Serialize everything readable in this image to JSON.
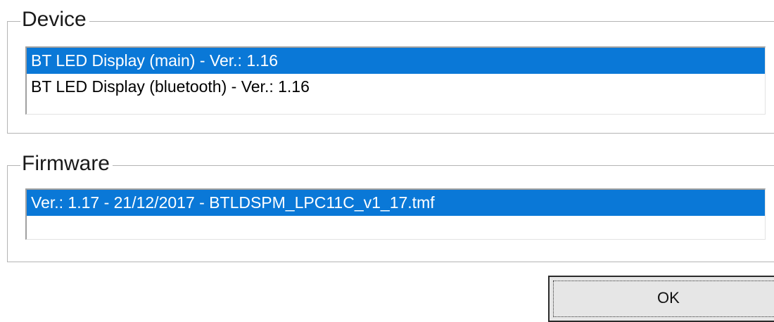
{
  "device_group": {
    "title": "Device",
    "items": [
      {
        "label": "BT LED Display (main) - Ver.: 1.16",
        "selected": true
      },
      {
        "label": "BT LED Display (bluetooth) - Ver.: 1.16",
        "selected": false
      }
    ]
  },
  "firmware_group": {
    "title": "Firmware",
    "items": [
      {
        "label": "Ver.: 1.17  - 21/12/2017 - BTLDSPM_LPC11C_v1_17.tmf",
        "selected": true
      }
    ]
  },
  "buttons": {
    "ok_label": "OK"
  },
  "colors": {
    "selection": "#0a78d7",
    "groupbox_border": "#b4b4b4",
    "button_face": "#e6e6e6"
  }
}
